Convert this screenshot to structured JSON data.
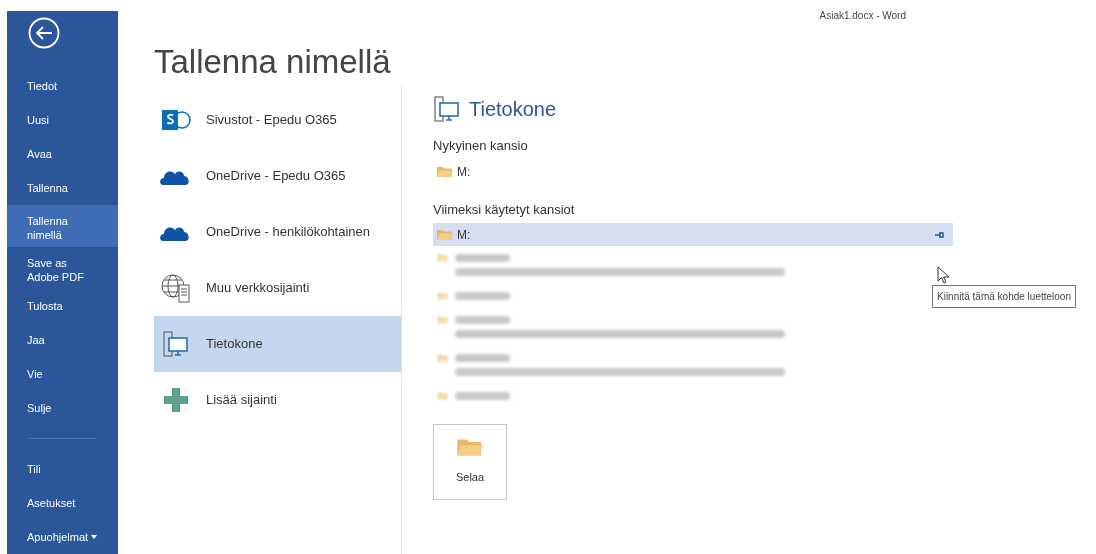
{
  "window": {
    "title": "Asiak1.docx - Word"
  },
  "sidebar": {
    "items": [
      {
        "label": "Tiedot",
        "selected": false
      },
      {
        "label": "Uusi",
        "selected": false
      },
      {
        "label": "Avaa",
        "selected": false
      },
      {
        "label": "Tallenna",
        "selected": false
      },
      {
        "label": "Tallenna nimellä",
        "selected": true
      },
      {
        "label": "Save as Adobe PDF",
        "selected": false
      },
      {
        "label": "Tulosta",
        "selected": false
      },
      {
        "label": "Jaa",
        "selected": false
      },
      {
        "label": "Vie",
        "selected": false
      },
      {
        "label": "Sulje",
        "selected": false
      }
    ],
    "footer_items": [
      {
        "label": "Tili",
        "dropdown": false
      },
      {
        "label": "Asetukset",
        "dropdown": false
      },
      {
        "label": "Apuohjelmat",
        "dropdown": true
      }
    ]
  },
  "page_title": "Tallenna nimellä",
  "places": [
    {
      "kind": "sharepoint",
      "label": "Sivustot - Epedu O365",
      "selected": false
    },
    {
      "kind": "cloud",
      "label": "OneDrive - Epedu O365",
      "selected": false
    },
    {
      "kind": "cloud",
      "label": "OneDrive - henkilökohtainen",
      "selected": false
    },
    {
      "kind": "network",
      "label": "Muu verkkosijainti",
      "selected": false
    },
    {
      "kind": "computer",
      "label": "Tietokone",
      "selected": true
    },
    {
      "kind": "add",
      "label": "Lisää sijainti",
      "selected": false
    }
  ],
  "detail": {
    "title": "Tietokone",
    "current_heading": "Nykyinen kansio",
    "current_folder": "M:",
    "recent_heading": "Viimeksi käytetyt kansiot",
    "recent": [
      {
        "kind": "folder",
        "name": "M:",
        "selected": true,
        "pin": true
      },
      {
        "kind": "blurred",
        "has_path": true
      },
      {
        "kind": "blurred",
        "has_path": false
      },
      {
        "kind": "blurred",
        "has_path": true
      },
      {
        "kind": "blurred",
        "has_path": true
      },
      {
        "kind": "blurred",
        "has_path": false
      }
    ],
    "tooltip": "Kiinnitä tämä kohde luetteloon",
    "browse": "Selaa"
  }
}
